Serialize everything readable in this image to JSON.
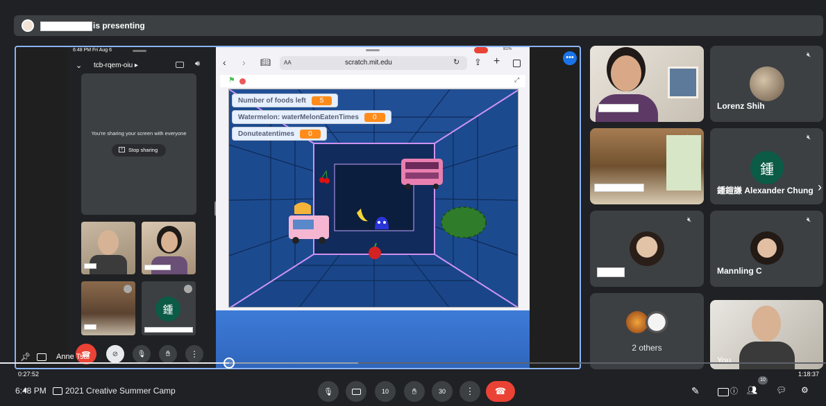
{
  "banner": {
    "presenting_text": "is presenting"
  },
  "phone": {
    "status_time": "6:48 PM  Fri Aug 6",
    "meeting_code": "tcb-rqem-oiu ▸",
    "sharing_text": "You're sharing your screen with everyone",
    "stop_sharing": "Stop sharing",
    "bottom_name": "Anne Tsai",
    "avatar_letter": "鍾"
  },
  "safari": {
    "url": "scratch.mit.edu",
    "aa": "AA",
    "status": "81%"
  },
  "scratch": {
    "monitors": [
      {
        "label": "Number of foods left",
        "value": "5"
      },
      {
        "label": "Watermelon: waterMelonEatenTimes",
        "value": "0"
      },
      {
        "label": "Donuteatentimes",
        "value": "0"
      }
    ]
  },
  "participants": [
    {
      "name": ""
    },
    {
      "name": "Lorenz Shih"
    },
    {
      "name": ""
    },
    {
      "name": "鍾鎧謙 Alexander Chung",
      "letter": "鍾"
    },
    {
      "name": ""
    },
    {
      "name": "Mannling C"
    },
    {
      "name": "2 others"
    },
    {
      "name": "You"
    }
  ],
  "timeline": {
    "elapsed": "0:27:52",
    "total": "1:18:37"
  },
  "footer": {
    "time": "6:48 PM",
    "meeting_title": "2021 Creative Summer Camp",
    "badge": "10",
    "skip_back": "10",
    "skip_forward": "30"
  },
  "colors": {
    "accent": "#1a73e8",
    "end_call": "#ea4335",
    "bg": "#202124",
    "tile": "#3c4043"
  }
}
